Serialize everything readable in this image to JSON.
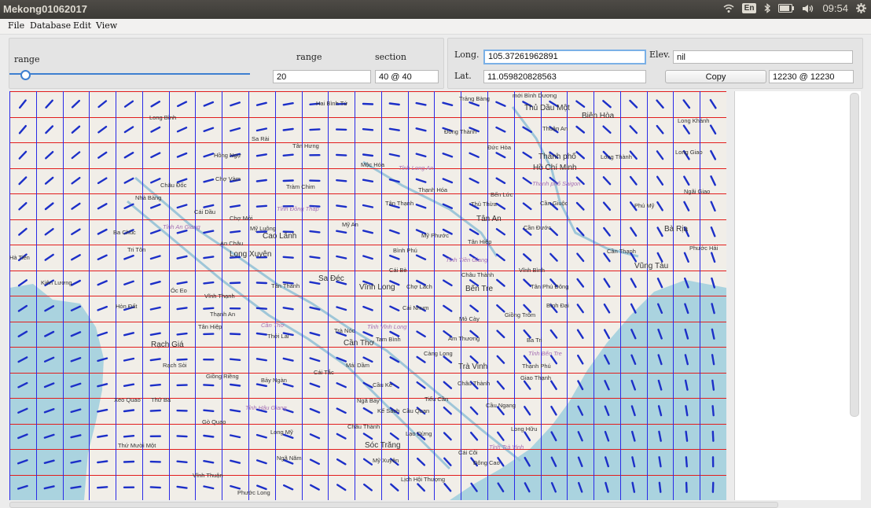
{
  "window": {
    "title": "Mekong01062017"
  },
  "tray": {
    "lang": "En",
    "time": "09:54"
  },
  "menu": [
    "File",
    "Database",
    "Edit",
    "View"
  ],
  "controls": {
    "range_slider_label": "range",
    "range_label": "range",
    "section_label": "section",
    "range_value": "20",
    "section_value": "40 @ 40",
    "long_label": "Long.",
    "long_value": "105.37261962891",
    "elev_label": "Elev.",
    "elev_value": "nil",
    "lat_label": "Lat.",
    "lat_value": "11.059820828563",
    "copy_button": "Copy",
    "id_value": "12230 @ 12230"
  },
  "map": {
    "grid": {
      "rows": 16,
      "cols": 27
    },
    "places": [
      {
        "name": "Hai Bình Tứ",
        "big": false,
        "prov": false
      },
      {
        "name": "Trảng Bàng",
        "big": false,
        "prov": false
      },
      {
        "name": "mới Bình Dương",
        "big": false,
        "prov": false
      },
      {
        "name": "Thủ Dầu Một",
        "big": true,
        "prov": false
      },
      {
        "name": "Biên Hòa",
        "big": true,
        "prov": false
      },
      {
        "name": "Long Khánh",
        "big": false,
        "prov": false
      },
      {
        "name": "Long Bình",
        "big": false,
        "prov": false
      },
      {
        "name": "Đồng Thành",
        "big": false,
        "prov": false
      },
      {
        "name": "Thuận An",
        "big": false,
        "prov": false
      },
      {
        "name": "Sa Rài",
        "big": false,
        "prov": false
      },
      {
        "name": "Tân Hưng",
        "big": false,
        "prov": false
      },
      {
        "name": "Đức Hòa",
        "big": false,
        "prov": false
      },
      {
        "name": "Thành phố",
        "big": true,
        "prov": false
      },
      {
        "name": "Hồ Chí Minh",
        "big": true,
        "prov": false
      },
      {
        "name": "Long Thành",
        "big": false,
        "prov": false
      },
      {
        "name": "Long Giao",
        "big": false,
        "prov": false
      },
      {
        "name": "Hồng Ngự",
        "big": false,
        "prov": false
      },
      {
        "name": "Mộc Hóa",
        "big": false,
        "prov": false
      },
      {
        "name": "Tỉnh Long An",
        "big": false,
        "prov": true
      },
      {
        "name": "Thành phố Saigon",
        "big": false,
        "prov": true
      },
      {
        "name": "Châu Đốc",
        "big": false,
        "prov": false
      },
      {
        "name": "Chợ Vàm",
        "big": false,
        "prov": false
      },
      {
        "name": "Tràm Chim",
        "big": false,
        "prov": false
      },
      {
        "name": "Thạnh Hóa",
        "big": false,
        "prov": false
      },
      {
        "name": "Bến Lức",
        "big": false,
        "prov": false
      },
      {
        "name": "Ngãi Giao",
        "big": false,
        "prov": false
      },
      {
        "name": "Nhà Bàng",
        "big": false,
        "prov": false
      },
      {
        "name": "Tân Thạnh",
        "big": false,
        "prov": false
      },
      {
        "name": "Thủ Thừa",
        "big": false,
        "prov": false
      },
      {
        "name": "Cần Giuộc",
        "big": false,
        "prov": false
      },
      {
        "name": "Phú Mỹ",
        "big": false,
        "prov": false
      },
      {
        "name": "Cái Dầu",
        "big": false,
        "prov": false
      },
      {
        "name": "Tỉnh Đồng Tháp",
        "big": false,
        "prov": true
      },
      {
        "name": "Chợ Mới",
        "big": false,
        "prov": false
      },
      {
        "name": "Tân An",
        "big": true,
        "prov": false
      },
      {
        "name": "Tỉnh An Giang",
        "big": false,
        "prov": true
      },
      {
        "name": "Mỹ Luông",
        "big": false,
        "prov": false
      },
      {
        "name": "Mỹ An",
        "big": false,
        "prov": false
      },
      {
        "name": "Cần Đước",
        "big": false,
        "prov": false
      },
      {
        "name": "Bà Rịa",
        "big": true,
        "prov": false
      },
      {
        "name": "Ba Chúc",
        "big": false,
        "prov": false
      },
      {
        "name": "An Châu",
        "big": false,
        "prov": false
      },
      {
        "name": "Cao Lãnh",
        "big": true,
        "prov": false
      },
      {
        "name": "Mỹ Phước",
        "big": false,
        "prov": false
      },
      {
        "name": "Tân Hiệp",
        "big": false,
        "prov": false
      },
      {
        "name": "Phước Hải",
        "big": false,
        "prov": false
      },
      {
        "name": "Tri Tôn",
        "big": false,
        "prov": false
      },
      {
        "name": "Long Xuyên",
        "big": true,
        "prov": false
      },
      {
        "name": "Bình Phú",
        "big": false,
        "prov": false
      },
      {
        "name": "Cần Thạnh",
        "big": false,
        "prov": false
      },
      {
        "name": "Hà Tiên",
        "big": false,
        "prov": false
      },
      {
        "name": "Tỉnh Tiền Giang",
        "big": false,
        "prov": true
      },
      {
        "name": "Vũng Tàu",
        "big": true,
        "prov": false
      },
      {
        "name": "Cái Bè",
        "big": false,
        "prov": false
      },
      {
        "name": "Châu Thành",
        "big": false,
        "prov": false
      },
      {
        "name": "Vĩnh Bình",
        "big": false,
        "prov": false
      },
      {
        "name": "Kiên Lương",
        "big": false,
        "prov": false
      },
      {
        "name": "Sa Đéc",
        "big": true,
        "prov": false
      },
      {
        "name": "Tân Thành",
        "big": false,
        "prov": false
      },
      {
        "name": "Vĩnh Long",
        "big": true,
        "prov": false
      },
      {
        "name": "Chợ Lách",
        "big": false,
        "prov": false
      },
      {
        "name": "Tân Phú Đông",
        "big": false,
        "prov": false
      },
      {
        "name": "Óc Eo",
        "big": false,
        "prov": false
      },
      {
        "name": "Vĩnh Thạnh",
        "big": false,
        "prov": false
      },
      {
        "name": "Bến Tre",
        "big": true,
        "prov": false
      },
      {
        "name": "Hòn Đất",
        "big": false,
        "prov": false
      },
      {
        "name": "Cái Nhum",
        "big": false,
        "prov": false
      },
      {
        "name": "Bình Đại",
        "big": false,
        "prov": false
      },
      {
        "name": "Thạnh An",
        "big": false,
        "prov": false
      },
      {
        "name": "Giồng Trôm",
        "big": false,
        "prov": false
      },
      {
        "name": "Mỏ Cày",
        "big": false,
        "prov": false
      },
      {
        "name": "Tân Hiệp",
        "big": false,
        "prov": false
      },
      {
        "name": "Cần Thơ",
        "big": false,
        "prov": true
      },
      {
        "name": "Trà Nóc",
        "big": false,
        "prov": false
      },
      {
        "name": "Tỉnh Vĩnh Long",
        "big": false,
        "prov": true
      },
      {
        "name": "Thới Lai",
        "big": false,
        "prov": false
      },
      {
        "name": "Cần Thơ",
        "big": true,
        "prov": false
      },
      {
        "name": "Tam Bình",
        "big": false,
        "prov": false
      },
      {
        "name": "Ám Thương",
        "big": false,
        "prov": false
      },
      {
        "name": "Ba Tri",
        "big": false,
        "prov": false
      },
      {
        "name": "Rạch Giá",
        "big": true,
        "prov": false
      },
      {
        "name": "Càng Long",
        "big": false,
        "prov": false
      },
      {
        "name": "Tỉnh Bến Tre",
        "big": false,
        "prov": true
      },
      {
        "name": "Rạch Sỏi",
        "big": false,
        "prov": false
      },
      {
        "name": "Mái Dầm",
        "big": false,
        "prov": false
      },
      {
        "name": "Trà Vinh",
        "big": true,
        "prov": false
      },
      {
        "name": "Thạnh Phú",
        "big": false,
        "prov": false
      },
      {
        "name": "Cái Tắc",
        "big": false,
        "prov": false
      },
      {
        "name": "Giồng Riềng",
        "big": false,
        "prov": false
      },
      {
        "name": "Giao Thạnh",
        "big": false,
        "prov": false
      },
      {
        "name": "Bảy Ngàn",
        "big": false,
        "prov": false
      },
      {
        "name": "Châu Thành",
        "big": false,
        "prov": false
      },
      {
        "name": "Cầu Kè",
        "big": false,
        "prov": false
      },
      {
        "name": "Xeo Quao",
        "big": false,
        "prov": false
      },
      {
        "name": "Thứ Ba",
        "big": false,
        "prov": false
      },
      {
        "name": "Ngã Bảy",
        "big": false,
        "prov": false
      },
      {
        "name": "Tiểu Cần",
        "big": false,
        "prov": false
      },
      {
        "name": "Tỉnh Hậu Giang",
        "big": false,
        "prov": true
      },
      {
        "name": "Kế Sách",
        "big": false,
        "prov": false
      },
      {
        "name": "Cầu Quan",
        "big": false,
        "prov": false
      },
      {
        "name": "Cầu Ngang",
        "big": false,
        "prov": false
      },
      {
        "name": "Gò Quao",
        "big": false,
        "prov": false
      },
      {
        "name": "Châu Thành",
        "big": false,
        "prov": false
      },
      {
        "name": "Long Hữu",
        "big": false,
        "prov": false
      },
      {
        "name": "Long Mỹ",
        "big": false,
        "prov": false
      },
      {
        "name": "Lạo Dừng",
        "big": false,
        "prov": false
      },
      {
        "name": "Thứ Mười Một",
        "big": false,
        "prov": false
      },
      {
        "name": "Sóc Trăng",
        "big": true,
        "prov": false
      },
      {
        "name": "Tỉnh Trà Vinh",
        "big": false,
        "prov": true
      },
      {
        "name": "Cái Côi",
        "big": false,
        "prov": false
      },
      {
        "name": "Ngã Năm",
        "big": false,
        "prov": false
      },
      {
        "name": "Mỹ Xuyên",
        "big": false,
        "prov": false
      },
      {
        "name": "Đông Cao",
        "big": false,
        "prov": false
      },
      {
        "name": "Vĩnh Thuận",
        "big": false,
        "prov": false
      },
      {
        "name": "Lịch Hội Thượng",
        "big": false,
        "prov": false
      },
      {
        "name": "Phước Long",
        "big": false,
        "prov": false
      }
    ]
  },
  "colors": {
    "grid_h": "#e21d1d",
    "grid_v": "#2a2ae6",
    "arrow": "#1c2fc8",
    "sea": "#aad3df",
    "land": "#f1eee8",
    "river": "#9ec6d8"
  }
}
